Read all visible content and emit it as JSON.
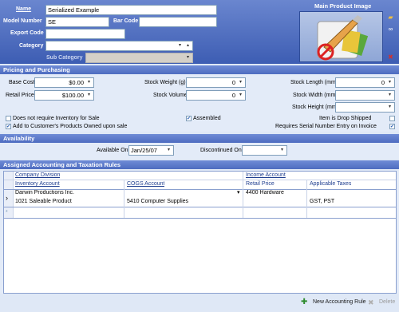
{
  "header": {
    "name_label": "Name",
    "name_value": "Serialized Example",
    "model_number_label": "Model Number",
    "model_number_value": "SE",
    "bar_code_label": "Bar Code",
    "bar_code_value": "",
    "export_code_label": "Export Code",
    "export_code_value": "",
    "category_label": "Category",
    "category_value": "",
    "sub_category_label": "Sub Category",
    "sub_category_value": "",
    "image_title": "Main Product Image",
    "image_icons": [
      "folder-open-icon",
      "link-icon",
      "delete-icon"
    ]
  },
  "pricing": {
    "section_title": "Pricing and Purchasing",
    "base_cost_label": "Base Cost",
    "base_cost_value": "$0.00",
    "retail_price_label": "Retail Price",
    "retail_price_value": "$100.00",
    "stock_weight_label": "Stock Weight (g)",
    "stock_weight_value": "0",
    "stock_volume_label": "Stock Volume",
    "stock_volume_value": "0",
    "stock_length_label": "Stock Length (mm)",
    "stock_length_value": "0",
    "stock_width_label": "Stock Width (mm)",
    "stock_width_value": "",
    "stock_height_label": "Stock Height (mm)",
    "stock_height_value": "",
    "no_inventory_label": "Does not require Inventory for Sale",
    "no_inventory_checked": false,
    "assembled_label": "Assembled",
    "assembled_checked": true,
    "drop_shipped_label": "Item is Drop Shipped",
    "drop_shipped_checked": false,
    "add_owned_label": "Add to Customer's Products Owned upon sale",
    "add_owned_checked": true,
    "serial_label": "Requires Serial Number Entry on Invoice",
    "serial_checked": true
  },
  "availability": {
    "section_title": "Availability",
    "available_on_label": "Available On",
    "available_on_value": "Jan/25/07",
    "discontinued_on_label": "Discontinued On",
    "discontinued_on_value": ""
  },
  "accounting": {
    "section_title": "Assigned Accounting and Taxation Rules",
    "headers_row1": [
      "Company Division",
      "Income Account"
    ],
    "headers_row2": [
      "Inventory Account",
      "COGS Account",
      "Retail Price",
      "Applicable Taxes"
    ],
    "rows": [
      {
        "line1": [
          "Darwin Productions Inc.",
          "4400 Hardware"
        ],
        "line2": [
          "1021 Saleable Product",
          "5410 Computer Supplies",
          "",
          "GST, PST"
        ]
      }
    ],
    "new_row_marker": "*",
    "current_row_marker": "›"
  },
  "footer": {
    "new_rule_label": "New Accounting Rule",
    "delete_label": "Delete"
  },
  "colors": {
    "header_bg": "#3d5db3",
    "section_bg": "#4d6cc0",
    "panel_bg": "#e3ebf8"
  }
}
